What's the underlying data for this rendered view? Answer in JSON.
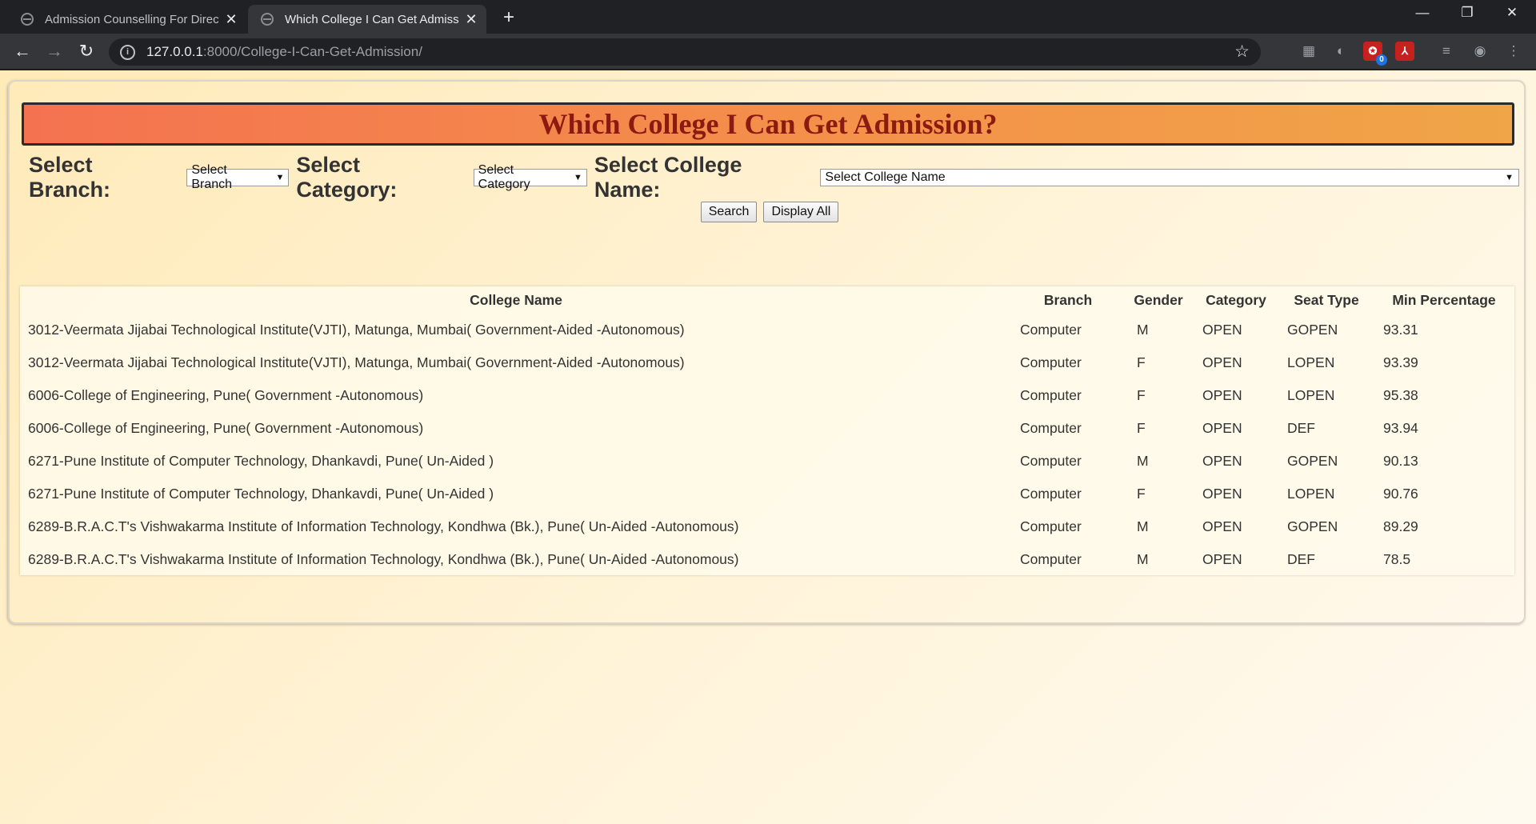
{
  "browser": {
    "tabs": [
      {
        "title": "Admission Counselling For Direct",
        "active": false
      },
      {
        "title": "Which College I Can Get Admission",
        "active": true
      }
    ],
    "url_host": "127.0.0.1",
    "url_path": ":8000/College-I-Can-Get-Admission/",
    "extension_badge": "0"
  },
  "page": {
    "heading": "Which College I Can Get Admission?",
    "filters": {
      "branch_label": "Select Branch:",
      "branch_value": "Select Branch",
      "category_label": "Select Category:",
      "category_value": "Select Category",
      "college_label": "Select College Name:",
      "college_value": "Select College Name"
    },
    "buttons": {
      "search": "Search",
      "display_all": "Display All"
    },
    "table": {
      "headers": [
        "College Name",
        "Branch",
        "Gender",
        "Category",
        "Seat Type",
        "Min Percentage"
      ],
      "rows": [
        [
          "3012-Veermata Jijabai Technological Institute(VJTI), Matunga, Mumbai( Government-Aided -Autonomous)",
          "Computer",
          "M",
          "OPEN",
          "GOPEN",
          "93.31"
        ],
        [
          "3012-Veermata Jijabai Technological Institute(VJTI), Matunga, Mumbai( Government-Aided -Autonomous)",
          "Computer",
          "F",
          "OPEN",
          "LOPEN",
          "93.39"
        ],
        [
          "6006-College of Engineering, Pune( Government -Autonomous)",
          "Computer",
          "F",
          "OPEN",
          "LOPEN",
          "95.38"
        ],
        [
          "6006-College of Engineering, Pune( Government -Autonomous)",
          "Computer",
          "F",
          "OPEN",
          "DEF",
          "93.94"
        ],
        [
          "6271-Pune Institute of Computer Technology, Dhankavdi, Pune( Un-Aided )",
          "Computer",
          "M",
          "OPEN",
          "GOPEN",
          "90.13"
        ],
        [
          "6271-Pune Institute of Computer Technology, Dhankavdi, Pune( Un-Aided )",
          "Computer",
          "F",
          "OPEN",
          "LOPEN",
          "90.76"
        ],
        [
          "6289-B.R.A.C.T's Vishwakarma Institute of Information Technology, Kondhwa (Bk.), Pune( Un-Aided -Autonomous)",
          "Computer",
          "M",
          "OPEN",
          "GOPEN",
          "89.29"
        ],
        [
          "6289-B.R.A.C.T's Vishwakarma Institute of Information Technology, Kondhwa (Bk.), Pune( Un-Aided -Autonomous)",
          "Computer",
          "M",
          "OPEN",
          "DEF",
          "78.5"
        ]
      ]
    }
  }
}
